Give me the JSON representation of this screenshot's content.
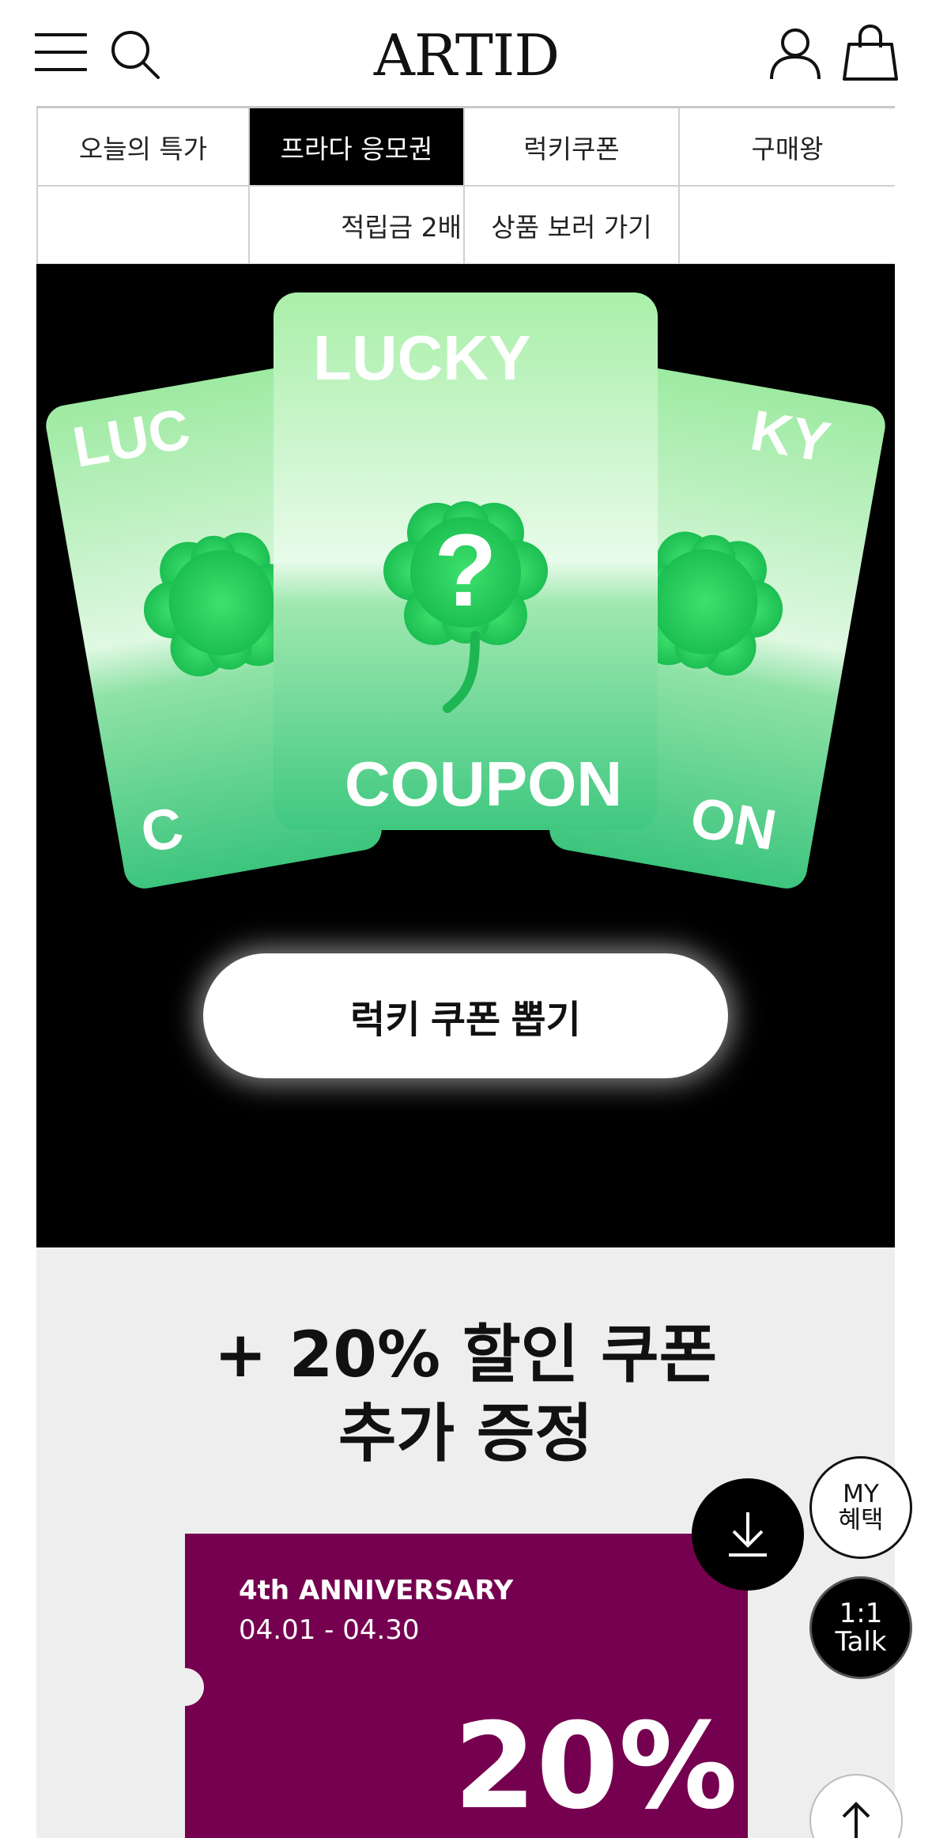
{
  "header": {
    "logo": "ARTID",
    "icons": [
      "menu-icon",
      "search-icon",
      "user-icon",
      "shopping-bag-icon"
    ]
  },
  "tabs": {
    "row1": [
      "오늘의 특가",
      "프라다 응모권",
      "럭키쿠폰",
      "구매왕"
    ],
    "row2": [
      "적립금 2배",
      "상품 보러 가기"
    ],
    "active_index": 1
  },
  "hero": {
    "card_top_text": "LUCKY",
    "card_bottom_text": "COUPON",
    "card_symbol": "?",
    "side_card_left_top": "LUC",
    "side_card_left_bottom": "C",
    "side_card_right_top": "KY",
    "side_card_right_bottom": "ON",
    "draw_button": "럭키 쿠폰 뽑기",
    "colors": {
      "background": "#000000",
      "card_light": "#a8f0a8",
      "card_dark": "#3ec77f",
      "clover": "#1fc95a"
    }
  },
  "promo": {
    "title_line1": "+ 20% 할인 쿠폰",
    "title_line2": "추가 증정",
    "coupon": {
      "event": "4th ANNIVERSARY",
      "dates": "04.01 - 04.30",
      "discount": "20%",
      "color": "#760050"
    }
  },
  "floating": {
    "download_icon": "download-icon",
    "my_line1": "MY",
    "my_line2": "혜택",
    "talk_line1": "1:1",
    "talk_line2": "Talk",
    "top_icon": "arrow-up-icon"
  }
}
